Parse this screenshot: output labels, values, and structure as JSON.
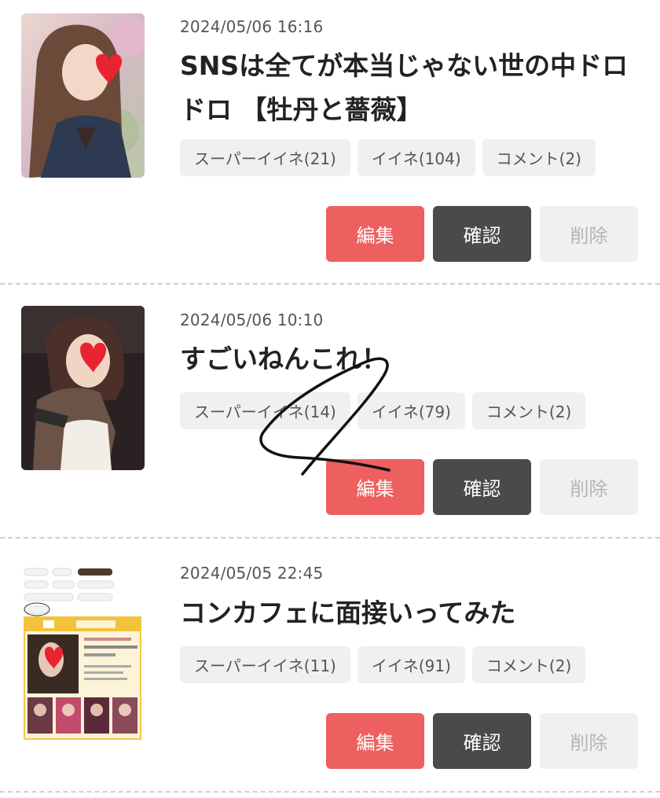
{
  "posts": [
    {
      "timestamp": "2024/05/06 16:16",
      "title": "SNSは全てが本当じゃない世の中ドロドロ 【牡丹と薔薇】",
      "tags": [
        "スーパーイイネ(21)",
        "イイネ(104)",
        "コメント(2)"
      ],
      "actions": {
        "edit": "編集",
        "confirm": "確認",
        "delete": "削除"
      }
    },
    {
      "timestamp": "2024/05/06 10:10",
      "title": "すごいねんこれ！",
      "tags": [
        "スーパーイイネ(14)",
        "イイネ(79)",
        "コメント(2)"
      ],
      "actions": {
        "edit": "編集",
        "confirm": "確認",
        "delete": "削除"
      }
    },
    {
      "timestamp": "2024/05/05 22:45",
      "title": "コンカフェに面接いってみた",
      "tags": [
        "スーパーイイネ(11)",
        "イイネ(91)",
        "コメント(2)"
      ],
      "actions": {
        "edit": "編集",
        "confirm": "確認",
        "delete": "削除"
      }
    }
  ],
  "colors": {
    "edit": "#ee5f5f",
    "confirm": "#4a4a4a",
    "delete_bg": "#f0f0f0",
    "tag_bg": "#f0f0f0",
    "divider": "#cfcfcf"
  }
}
